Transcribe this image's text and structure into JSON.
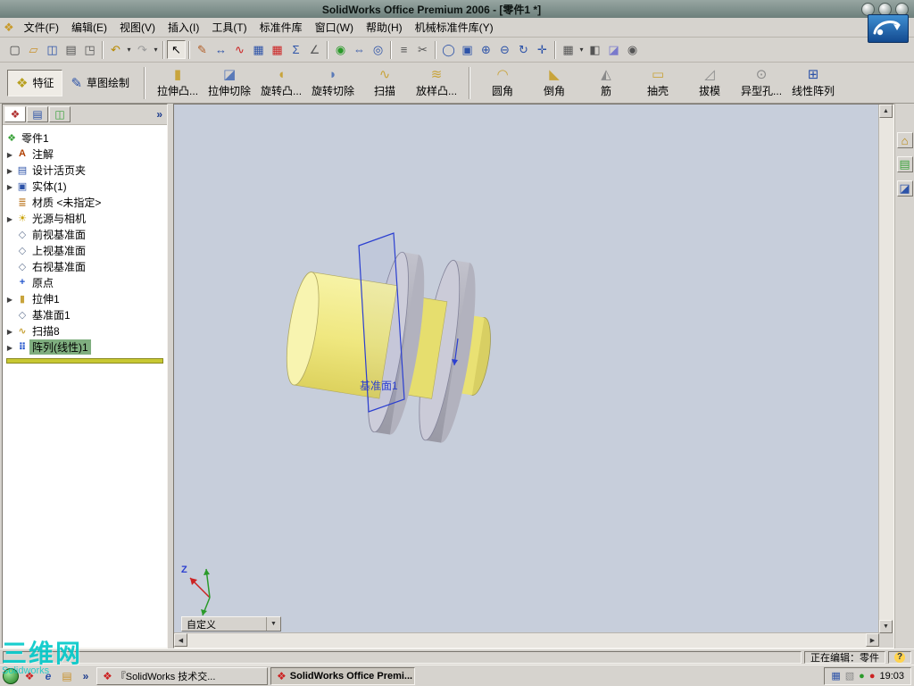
{
  "colors": {
    "titlebar": "#7f928f",
    "toolbar_bg": "#d6d3ce",
    "viewport_bg": "#c7cedb",
    "tree_selection_green": "#7fae7f",
    "accent_blue": "#2d53a8",
    "model_yellow": "#efe77f",
    "model_gray": "#b2b2be",
    "plane_wireframe_blue": "#2b3fd0",
    "watermark_cyan": "#00c9c9"
  },
  "window": {
    "title": "SolidWorks Office Premium 2006 - [零件1 *]"
  },
  "menu": {
    "app_icon_glyph": "❖",
    "items": [
      "文件(F)",
      "编辑(E)",
      "视图(V)",
      "插入(I)",
      "工具(T)",
      "标准件库",
      "窗口(W)",
      "帮助(H)",
      "机械标准件库(Y)"
    ]
  },
  "standard_toolbar": {
    "icons": [
      {
        "name": "new-document",
        "glyph": "▢"
      },
      {
        "name": "open-folder",
        "glyph": "▱"
      },
      {
        "name": "save",
        "glyph": "◫"
      },
      {
        "name": "print",
        "glyph": "▤"
      },
      {
        "name": "print-preview",
        "glyph": "◳"
      },
      {
        "name": "undo",
        "glyph": "↶"
      },
      {
        "name": "redo",
        "glyph": "↷"
      },
      {
        "name": "select-arrow",
        "glyph": "↖"
      },
      {
        "name": "sketch",
        "glyph": "✎"
      },
      {
        "name": "smart-dimension",
        "glyph": "↔"
      },
      {
        "name": "spline",
        "glyph": "∿"
      },
      {
        "name": "grid",
        "glyph": "▦"
      },
      {
        "name": "design-table",
        "glyph": "▦"
      },
      {
        "name": "equations",
        "glyph": "Σ"
      },
      {
        "name": "measure",
        "glyph": "∠"
      },
      {
        "name": "rebuild",
        "glyph": "◉"
      },
      {
        "name": "mate",
        "glyph": "⇔"
      },
      {
        "name": "constraint",
        "glyph": "◎"
      },
      {
        "name": "list",
        "glyph": "≡"
      },
      {
        "name": "cut",
        "glyph": "✂"
      },
      {
        "name": "zoom-fit",
        "glyph": "◯"
      },
      {
        "name": "zoom-area",
        "glyph": "▣"
      },
      {
        "name": "zoom-in",
        "glyph": "⊕"
      },
      {
        "name": "zoom-out",
        "glyph": "⊖"
      },
      {
        "name": "rotate-view",
        "glyph": "↻"
      },
      {
        "name": "pan",
        "glyph": "✛"
      },
      {
        "name": "view-orientation",
        "glyph": "▦"
      },
      {
        "name": "display-style",
        "glyph": "◧"
      },
      {
        "name": "section-view",
        "glyph": "◪"
      },
      {
        "name": "camera",
        "glyph": "◉"
      }
    ]
  },
  "feature_toolbar": {
    "buttons": [
      {
        "name": "features-tab",
        "glyph": "❖",
        "label": "特征"
      },
      {
        "name": "sketch-tab",
        "glyph": "✎",
        "label": "草图绘制"
      },
      {
        "name": "extruded-boss",
        "glyph": "▮",
        "label": "拉伸凸..."
      },
      {
        "name": "extruded-cut",
        "glyph": "◪",
        "label": "拉伸切除"
      },
      {
        "name": "revolved-boss",
        "glyph": "◖",
        "label": "旋转凸..."
      },
      {
        "name": "revolved-cut",
        "glyph": "◗",
        "label": "旋转切除"
      },
      {
        "name": "sweep",
        "glyph": "∿",
        "label": "扫描"
      },
      {
        "name": "loft",
        "glyph": "≋",
        "label": "放样凸..."
      },
      {
        "name": "fillet",
        "glyph": "◠",
        "label": "圆角"
      },
      {
        "name": "chamfer",
        "glyph": "◣",
        "label": "倒角"
      },
      {
        "name": "rib",
        "glyph": "◭",
        "label": "筋"
      },
      {
        "name": "shell",
        "glyph": "▭",
        "label": "抽壳"
      },
      {
        "name": "draft",
        "glyph": "◿",
        "label": "拔模"
      },
      {
        "name": "hole-wizard",
        "glyph": "⊙",
        "label": "异型孔..."
      },
      {
        "name": "linear-pattern",
        "glyph": "⊞",
        "label": "线性阵列"
      }
    ]
  },
  "feature_tree": {
    "tabs": [
      {
        "name": "featuremanager-tab",
        "glyph": "❖"
      },
      {
        "name": "propertymanager-tab",
        "glyph": "▤"
      },
      {
        "name": "configurationmanager-tab",
        "glyph": "◫"
      }
    ],
    "collapse_glyph": "»",
    "root": {
      "glyph": "❖",
      "label": "零件1"
    },
    "items": [
      {
        "glyph": "A",
        "label": "注解"
      },
      {
        "glyph": "▤",
        "label": "设计活页夹"
      },
      {
        "glyph": "▣",
        "label": "实体(1)"
      },
      {
        "glyph": "≣",
        "label": "材质 <未指定>"
      },
      {
        "glyph": "☀",
        "label": "光源与相机"
      },
      {
        "glyph": "◇",
        "label": "前视基准面"
      },
      {
        "glyph": "◇",
        "label": "上视基准面"
      },
      {
        "glyph": "◇",
        "label": "右视基准面"
      },
      {
        "glyph": "+",
        "label": "原点"
      },
      {
        "glyph": "▮",
        "label": "拉伸1"
      },
      {
        "glyph": "◇",
        "label": "基准面1"
      },
      {
        "glyph": "∿",
        "label": "扫描8"
      },
      {
        "glyph": "⠿",
        "label": "阵列(线性)1"
      }
    ]
  },
  "viewport": {
    "plane_label": "基准面1",
    "triad_z_label": "Z",
    "view_selector_value": "自定义"
  },
  "task_pane": {
    "icons": [
      {
        "name": "home-icon",
        "glyph": "⌂"
      },
      {
        "name": "design-library-icon",
        "glyph": "▤"
      },
      {
        "name": "file-explorer-icon",
        "glyph": "◪"
      }
    ]
  },
  "status_bar": {
    "editing_status": "正在编辑：零件",
    "help_glyph": "?"
  },
  "taskbar": {
    "quick_launch": [
      {
        "name": "solidworks-icon",
        "glyph": "❖"
      },
      {
        "name": "browser-icon",
        "glyph": "e"
      },
      {
        "name": "folder-icon",
        "glyph": "▤"
      }
    ],
    "quick_launch_overflow": "»",
    "tasks": [
      {
        "label": "『SolidWorks 技术交...",
        "icon_glyph": "❖"
      },
      {
        "label": "SolidWorks Office Premi...",
        "icon_glyph": "❖"
      }
    ],
    "tray_icons": [
      {
        "name": "app-tray-icon",
        "glyph": "▦"
      },
      {
        "name": "ime-tray-icon",
        "glyph": "▧"
      },
      {
        "name": "antivirus-tray-icon",
        "glyph": "●"
      },
      {
        "name": "alert-tray-icon",
        "glyph": "●"
      }
    ],
    "clock": "19:03"
  },
  "watermark": {
    "text": "三维网",
    "subtext": "Solidworks"
  }
}
